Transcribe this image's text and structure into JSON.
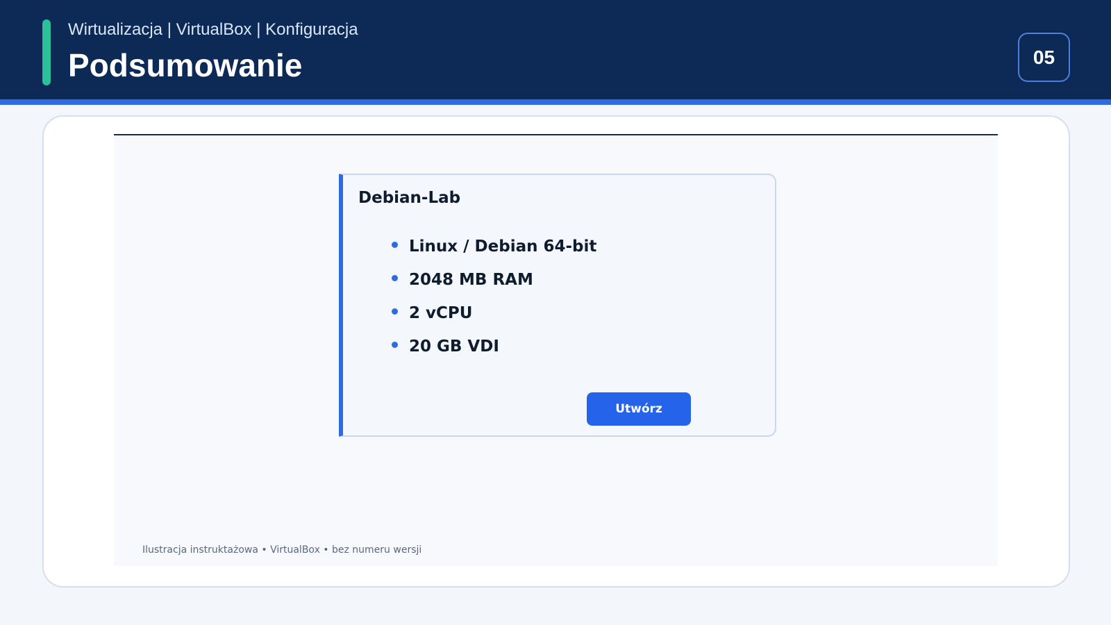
{
  "header": {
    "breadcrumb": "Wirtualizacja | VirtualBox | Konfiguracja",
    "title": "Podsumowanie",
    "slide_number": "05"
  },
  "dialog": {
    "vm_name": "Debian-Lab",
    "specs": [
      "Linux / Debian 64-bit",
      "2048 MB RAM",
      "2 vCPU",
      "20 GB VDI"
    ],
    "create_label": "Utwórz"
  },
  "caption": "Ilustracja instruktażowa • VirtualBox • bez numeru wersji",
  "colors": {
    "header_bg": "#0c2a55",
    "accent_green": "#2bbf9a",
    "accent_blue": "#2f6ae0",
    "button_blue": "#2563eb"
  }
}
